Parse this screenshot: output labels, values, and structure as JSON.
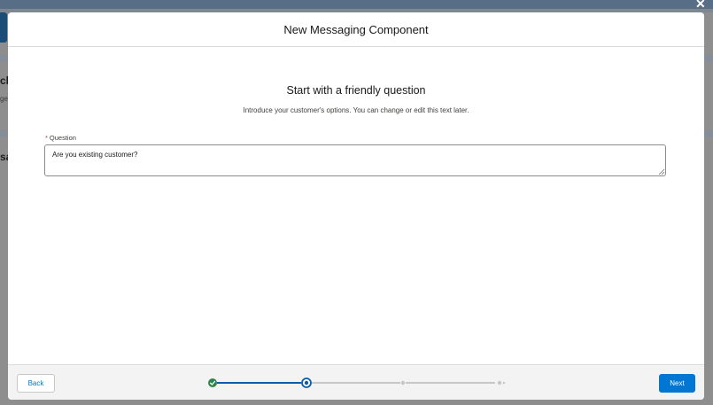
{
  "modal": {
    "title": "New Messaging Component"
  },
  "content": {
    "heading": "Start with a friendly question",
    "subheading": "Introduce your customer's options. You can change or edit this text later.",
    "question_field": {
      "required_marker": "*",
      "label": "Question",
      "value": "Are you existing customer?"
    }
  },
  "footer": {
    "back_label": "Back",
    "next_label": "Next",
    "progress": {
      "total_steps": 4,
      "completed_steps": 1,
      "current_step": 2
    }
  },
  "background": {
    "partial_text_1": "ch",
    "partial_text_2": "ge",
    "partial_text_3": "sa",
    "close_glyph": "✕"
  },
  "colors": {
    "brand": "#0176d3",
    "complete": "#2e844a",
    "current_ring": "#0b5cab",
    "track_inactive": "#c9c7c5"
  }
}
